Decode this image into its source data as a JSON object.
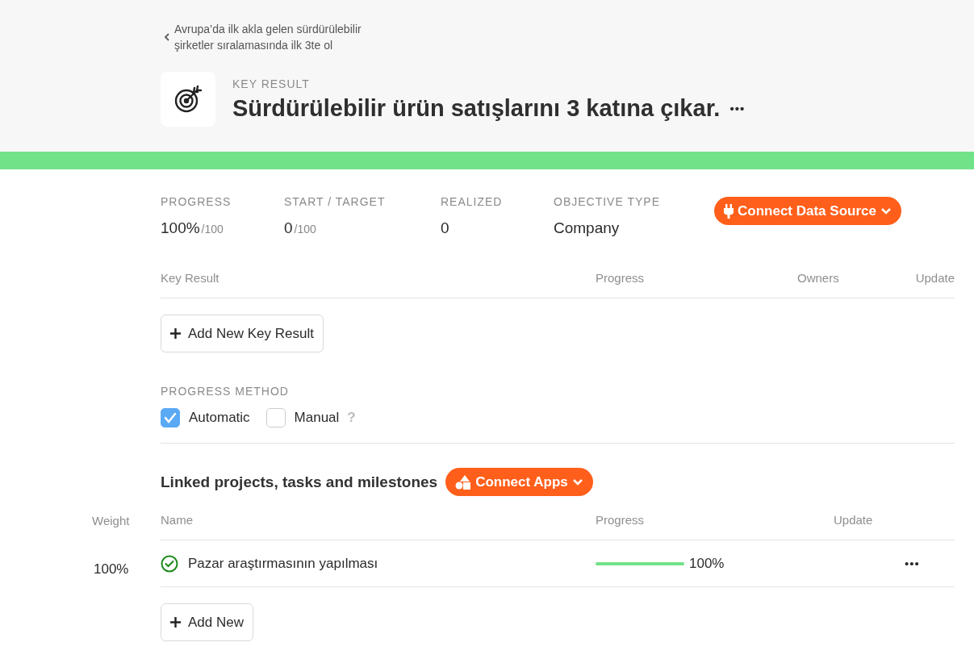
{
  "back_link": {
    "label": "Avrupa’da ilk akla gelen sürdürülebilir şirketler sıralamasında ilk 3te ol"
  },
  "header": {
    "eyebrow": "KEY RESULT",
    "title": "Sürdürülebilir ürün satışlarını 3 katına çıkar.",
    "more": "•••"
  },
  "overall_progress": {
    "level": 1
  },
  "stats": [
    {
      "label": "PROGRESS",
      "value": "100%",
      "suffix": "/100"
    },
    {
      "label": "START / TARGET",
      "value": "0",
      "suffix": "/100"
    },
    {
      "label": "REALIZED",
      "value": "0"
    },
    {
      "label": "OBJECTIVE TYPE",
      "value": "Company"
    }
  ],
  "connect_data_source": {
    "label": "Connect Data Source"
  },
  "key_results_table": {
    "columns": [
      "Key Result",
      "Progress",
      "Owners",
      "Update"
    ]
  },
  "add_key_result": {
    "label": "Add New Key Result"
  },
  "progress_method": {
    "title": "PROGRESS METHOD",
    "options": [
      {
        "label": "Automatic",
        "checked": true
      },
      {
        "label": "Manual",
        "checked": false
      }
    ],
    "help": "?"
  },
  "linked": {
    "title": "Linked projects, tasks and milestones",
    "connect_apps": "Connect Apps",
    "columns": [
      "Weight",
      "Name",
      "Progress",
      "Update"
    ],
    "rows": [
      {
        "weight": "100%",
        "name": "Pazar araştırmasının yapılması",
        "done": true,
        "level": 1,
        "progress": "100%",
        "more": "•••"
      }
    ],
    "add": "Add New"
  }
}
